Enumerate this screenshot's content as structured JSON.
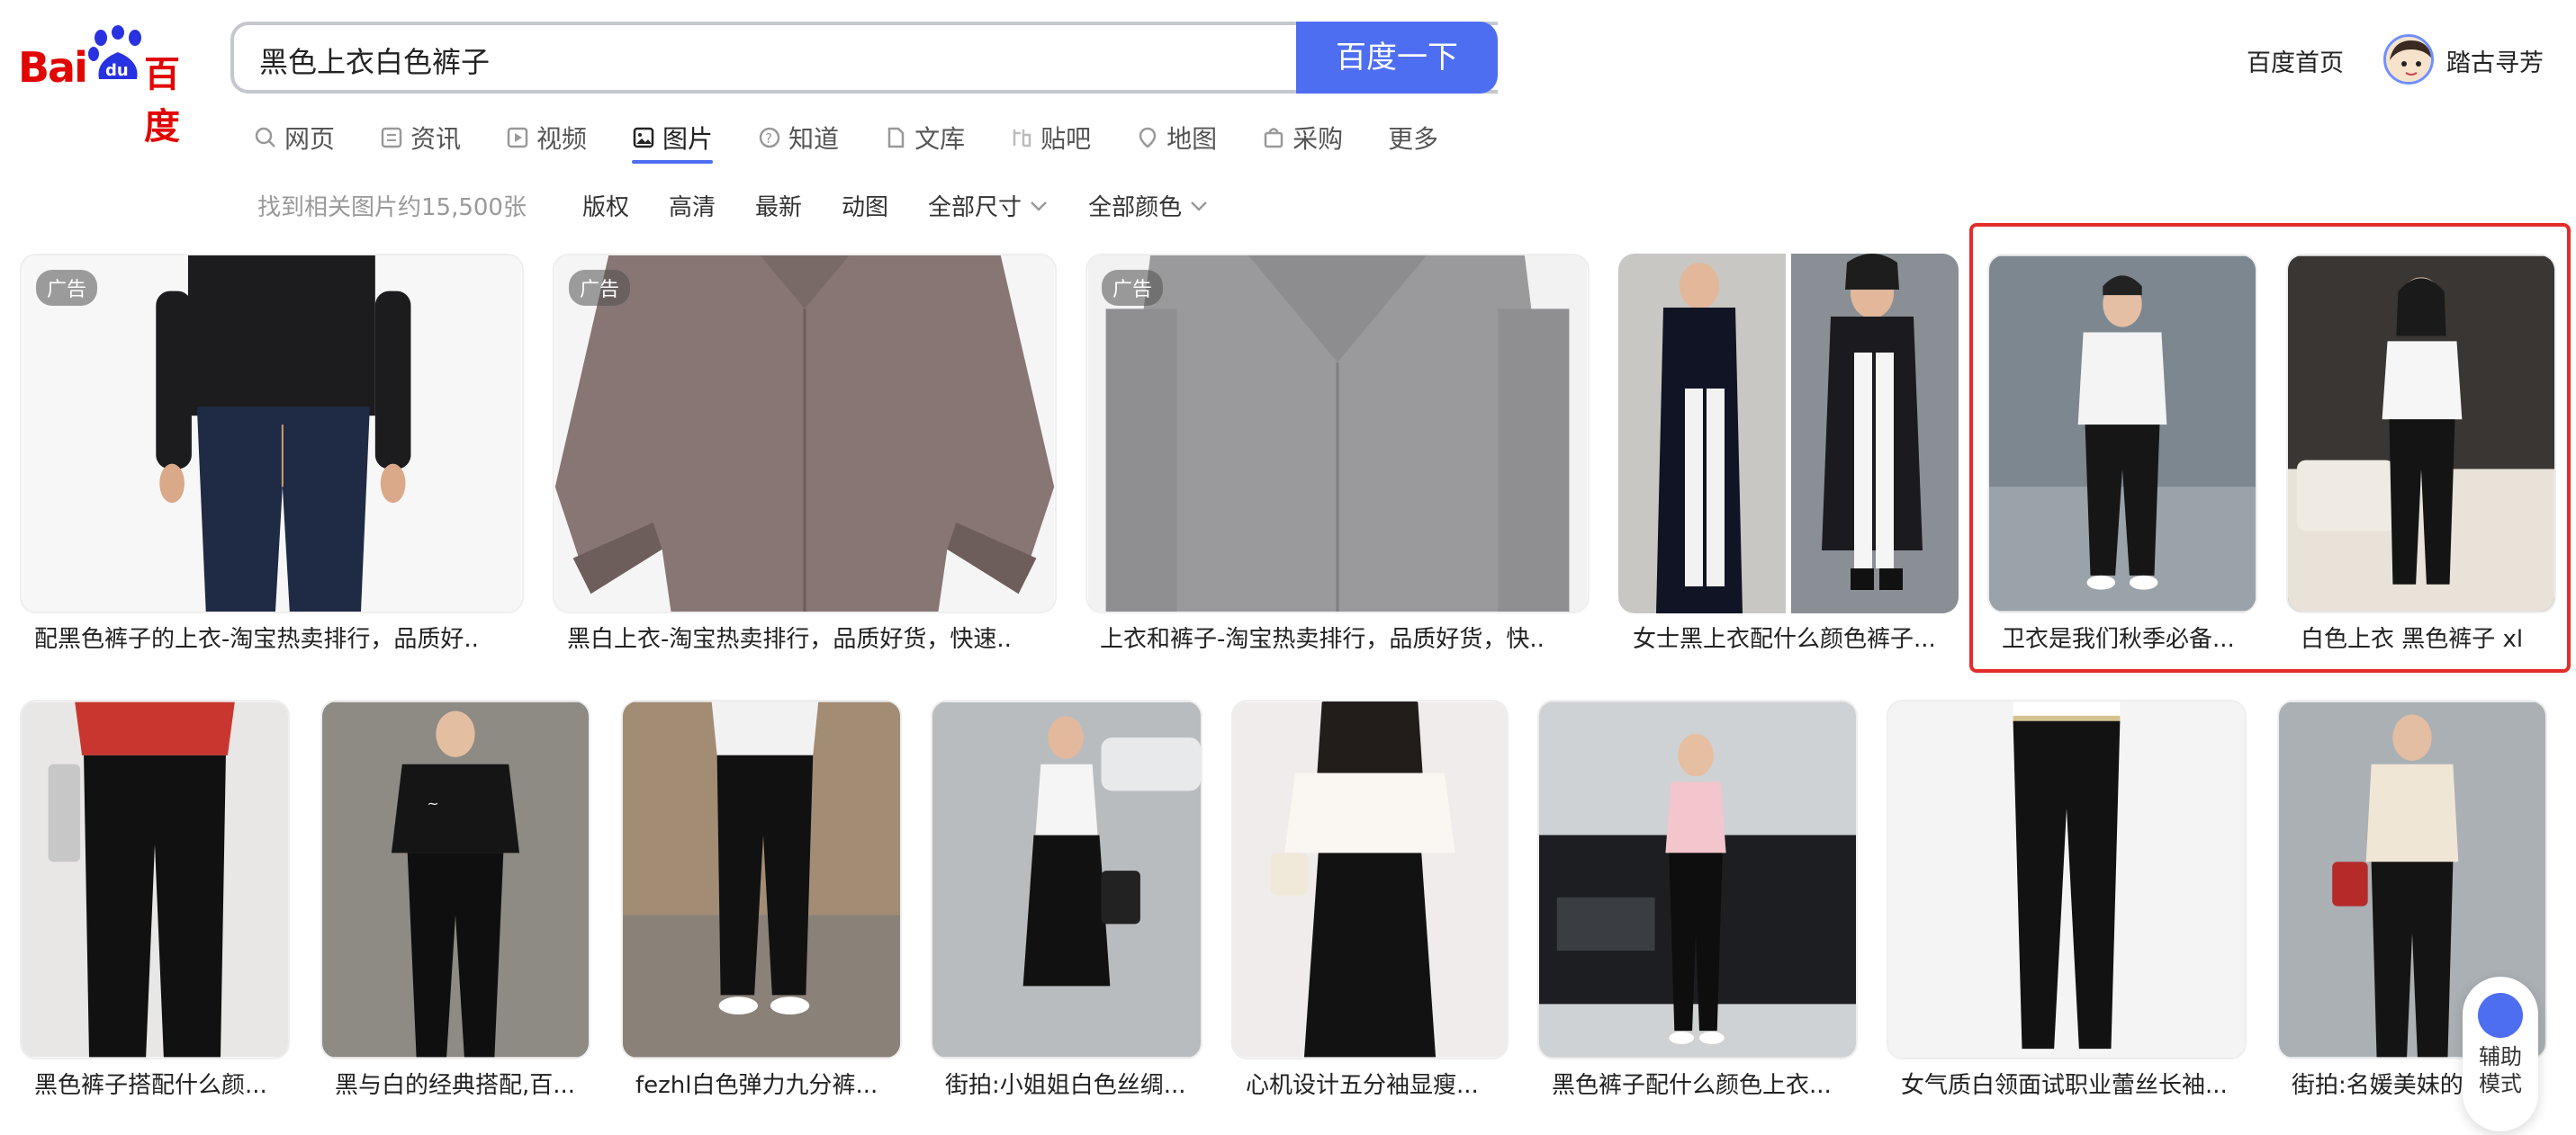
{
  "header": {
    "logo_latin": "Bai",
    "logo_du": "du",
    "logo_cn": "百度",
    "search_query": "黑色上衣白色裤子",
    "search_button": "百度一下",
    "home_link": "百度首页",
    "username": "踏古寻芳"
  },
  "tabs": [
    {
      "label": "网页",
      "icon": "search-icon"
    },
    {
      "label": "资讯",
      "icon": "news-icon"
    },
    {
      "label": "视频",
      "icon": "video-icon"
    },
    {
      "label": "图片",
      "icon": "image-icon",
      "active": true
    },
    {
      "label": "知道",
      "icon": "question-icon"
    },
    {
      "label": "文库",
      "icon": "document-icon"
    },
    {
      "label": "贴吧",
      "icon": "tieba-icon"
    },
    {
      "label": "地图",
      "icon": "map-icon"
    },
    {
      "label": "采购",
      "icon": "shopping-bag-icon"
    },
    {
      "label": "更多",
      "icon": ""
    }
  ],
  "filters": {
    "result_count": "找到相关图片约15,500张",
    "items": [
      "版权",
      "高清",
      "最新",
      "动图"
    ],
    "dropdowns": [
      "全部尺寸",
      "全部颜色"
    ]
  },
  "ad_badge": "广告",
  "row1": [
    {
      "caption": "配黑色裤子的上衣-淘宝热卖排行，品质好..",
      "ad": true
    },
    {
      "caption": "黑白上衣-淘宝热卖排行，品质好货，快速..",
      "ad": true
    },
    {
      "caption": "上衣和裤子-淘宝热卖排行，品质好货，快..",
      "ad": true
    },
    {
      "caption": "女士黑上衣配什么颜色裤子...",
      "ad": false
    },
    {
      "caption": "卫衣是我们秋季必备...",
      "ad": false
    },
    {
      "caption": "白色上衣 黑色裤子 xl",
      "ad": false
    }
  ],
  "row2": [
    {
      "caption": "黑色裤子搭配什么颜..."
    },
    {
      "caption": "黑与白的经典搭配,百..."
    },
    {
      "caption": "fezhl白色弹力九分裤..."
    },
    {
      "caption": "街拍:小姐姐白色丝绸..."
    },
    {
      "caption": "心机设计五分袖显瘦..."
    },
    {
      "caption": "黑色裤子配什么颜色上衣..."
    },
    {
      "caption": "女气质白领面试职业蕾丝长袖..."
    },
    {
      "caption": "街拍:名媛美妹的"
    }
  ],
  "assist": {
    "line1": "辅助",
    "line2": "模式"
  },
  "colors": {
    "brand_blue": "#4e6ef2",
    "brand_red": "#e10601",
    "highlight_red": "#e22d2a"
  }
}
